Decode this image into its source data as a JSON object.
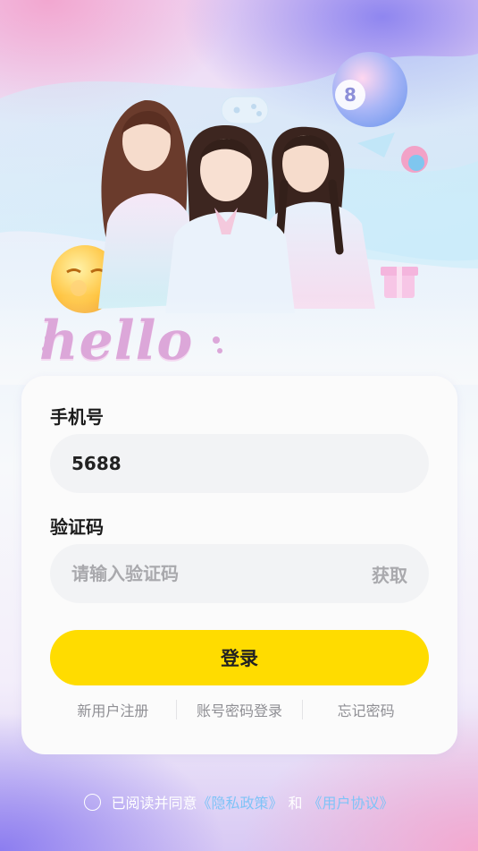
{
  "hero": {
    "badge_number": "8",
    "greeting": "hello"
  },
  "form": {
    "phone_label": "手机号",
    "phone_value": "5688",
    "code_label": "验证码",
    "code_placeholder": "请输入验证码",
    "get_code_label": "获取",
    "login_label": "登录"
  },
  "links": {
    "register": "新用户注册",
    "password_login": "账号密码登录",
    "forgot_password": "忘记密码"
  },
  "agreement": {
    "prefix": "已阅读并同意",
    "privacy_policy": "《隐私政策》",
    "and": "和",
    "user_agreement": "《用户协议》"
  },
  "colors": {
    "accent": "#ffdc00",
    "link": "#7fc3f7",
    "greeting": "#dca7d9"
  },
  "icons": [
    "eight-ball-icon",
    "game-controller-icon",
    "emoji-face-icon",
    "gift-box-icon",
    "radio-unchecked-icon"
  ]
}
